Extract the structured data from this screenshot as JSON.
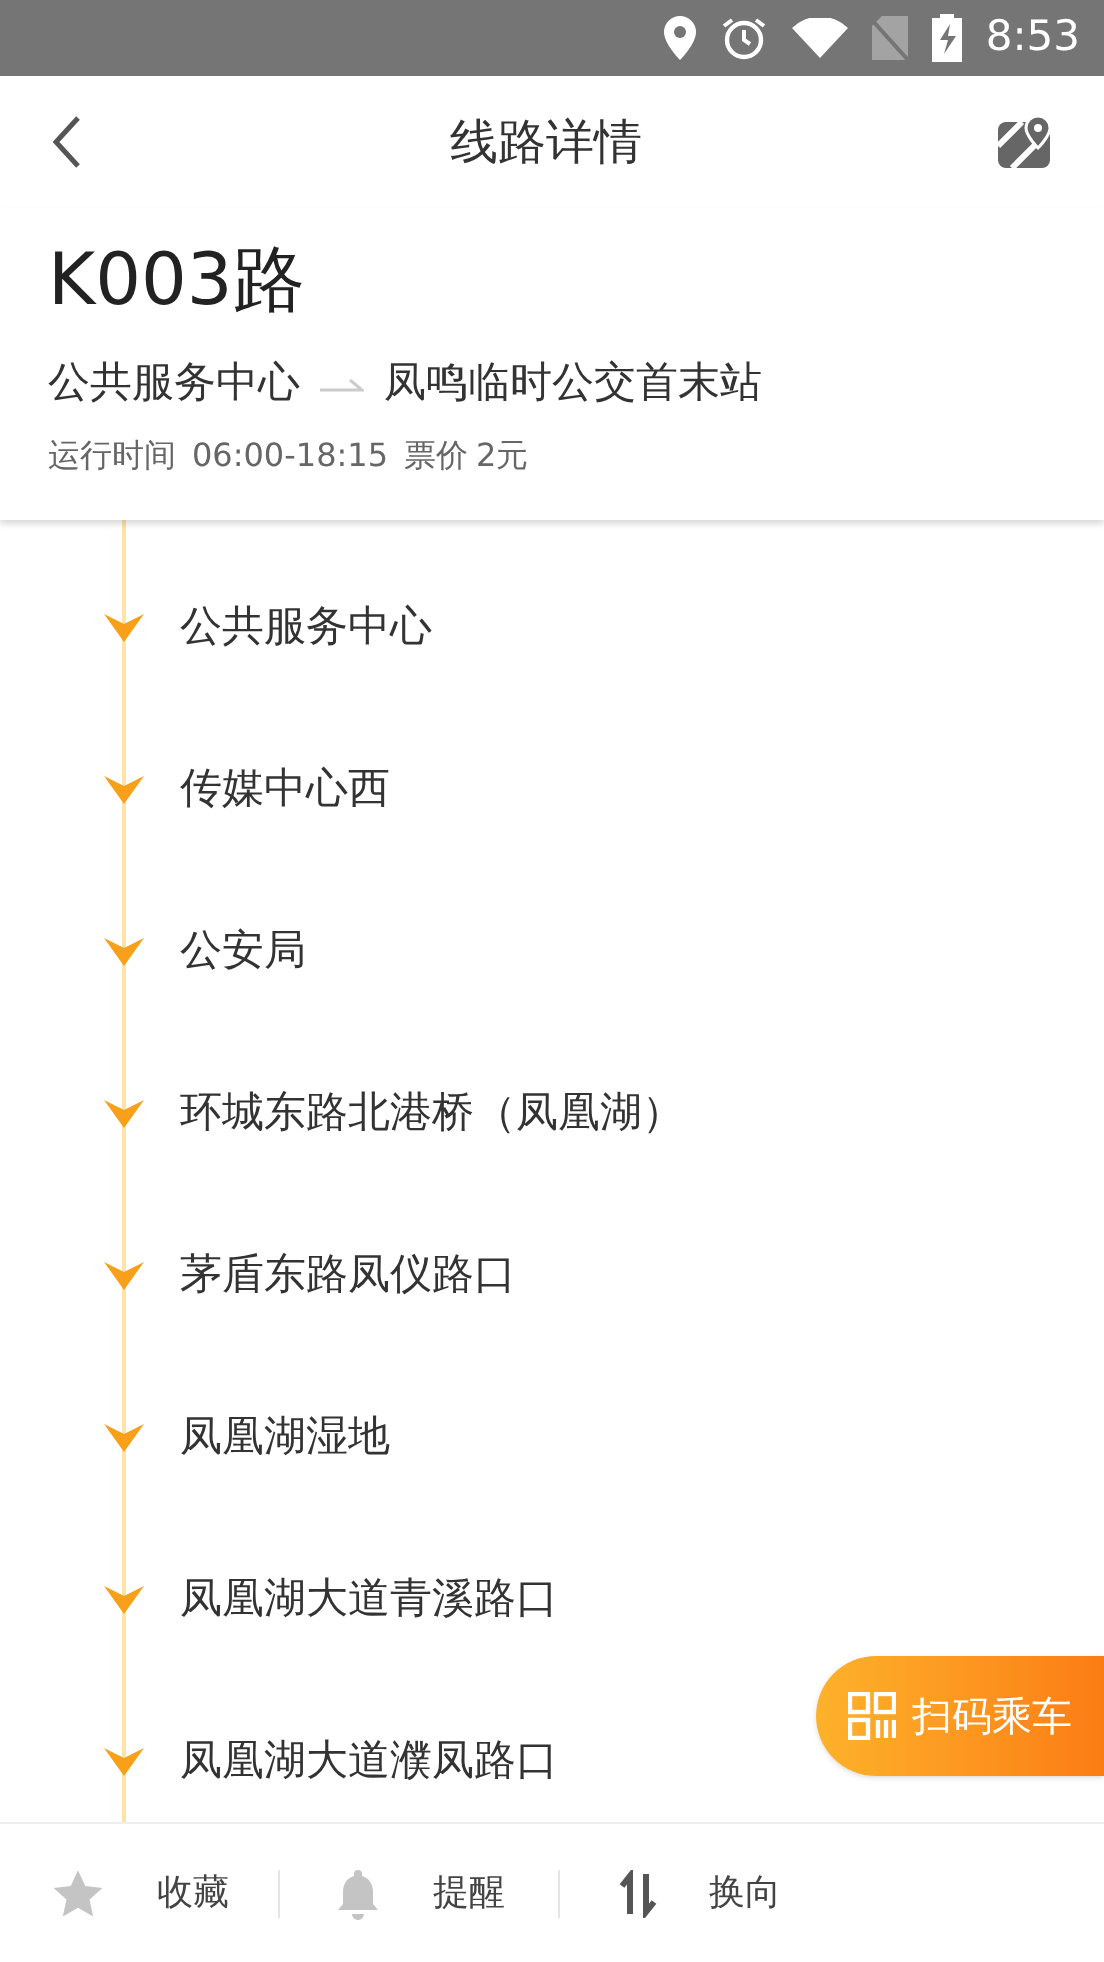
{
  "status_bar": {
    "time": "8:53"
  },
  "header": {
    "title": "线路详情"
  },
  "route": {
    "name": "K003路",
    "from": "公共服务中心",
    "to": "凤鸣临时公交首末站",
    "hours_label": "运行时间",
    "hours": "06:00-18:15",
    "fare_label": "票价",
    "fare": "2元"
  },
  "stops": [
    "公共服务中心",
    "传媒中心西",
    "公安局",
    "环城东路北港桥（凤凰湖）",
    "茅盾东路凤仪路口",
    "凤凰湖湿地",
    "凤凰湖大道青溪路口",
    "凤凰湖大道濮凤路口"
  ],
  "scan_button": {
    "label": "扫码乘车"
  },
  "bottom_bar": [
    {
      "kind": "favorite",
      "label": "收藏"
    },
    {
      "kind": "remind",
      "label": "提醒"
    },
    {
      "kind": "reverse",
      "label": "换向"
    }
  ]
}
